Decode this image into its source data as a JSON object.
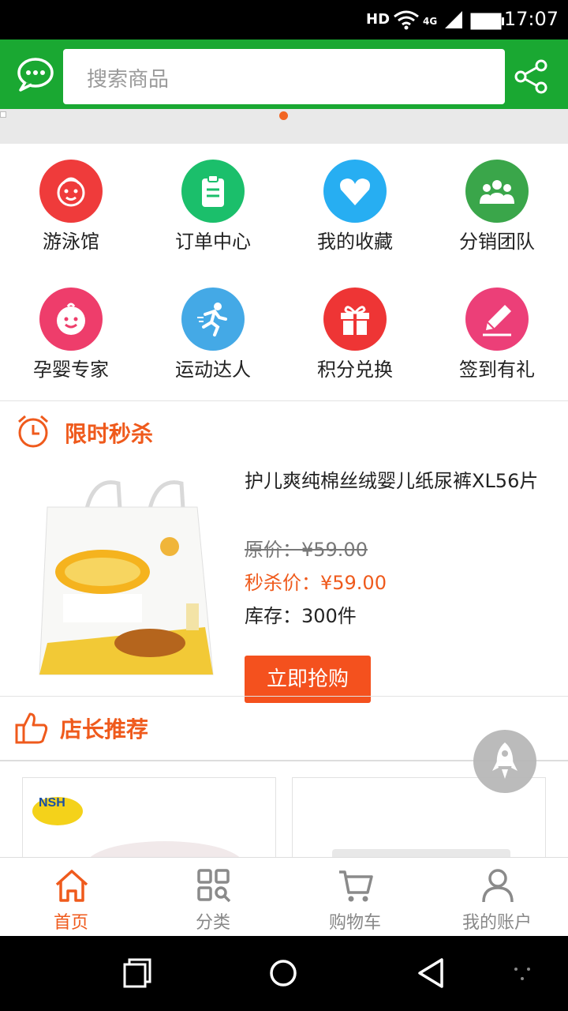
{
  "status_bar": {
    "time": "17:07",
    "network": "4G",
    "hd": "HD"
  },
  "header": {
    "search_placeholder": "搜索商品",
    "icons": [
      "chat-icon",
      "share-icon"
    ]
  },
  "colors": {
    "brand_green": "#1aa832",
    "accent_orange": "#ef5a1c",
    "button_orange": "#f4511e"
  },
  "quick_menu": [
    {
      "label": "游泳馆",
      "icon": "baby-face-icon",
      "color": "#ef3b3b"
    },
    {
      "label": "订单中心",
      "icon": "clipboard-icon",
      "color": "#1bbf6b"
    },
    {
      "label": "我的收藏",
      "icon": "heart-icon",
      "color": "#27aef2"
    },
    {
      "label": "分销团队",
      "icon": "team-icon",
      "color": "#3aa64a"
    },
    {
      "label": "孕婴专家",
      "icon": "smiley-baby-icon",
      "color": "#ee3d6b"
    },
    {
      "label": "运动达人",
      "icon": "runner-icon",
      "color": "#44a9e6"
    },
    {
      "label": "积分兑换",
      "icon": "gift-icon",
      "color": "#ee3535"
    },
    {
      "label": "签到有礼",
      "icon": "pencil-icon",
      "color": "#ec3f78"
    }
  ],
  "flash_sale": {
    "title": "限时秒杀",
    "product": {
      "name": "护儿爽纯棉丝绒婴儿纸尿裤XL56片",
      "original_price": "原价：¥59.00",
      "sale_price": "秒杀价：¥59.00",
      "stock": "库存：300件",
      "buy_label": "立即抢购"
    }
  },
  "recommend": {
    "title": "店长推荐",
    "brand_text": "NSH"
  },
  "bottom_nav": [
    {
      "label": "首页",
      "icon": "home-icon",
      "active": true
    },
    {
      "label": "分类",
      "icon": "category-icon",
      "active": false
    },
    {
      "label": "购物车",
      "icon": "cart-icon",
      "active": false
    },
    {
      "label": "我的账户",
      "icon": "user-icon",
      "active": false
    }
  ]
}
